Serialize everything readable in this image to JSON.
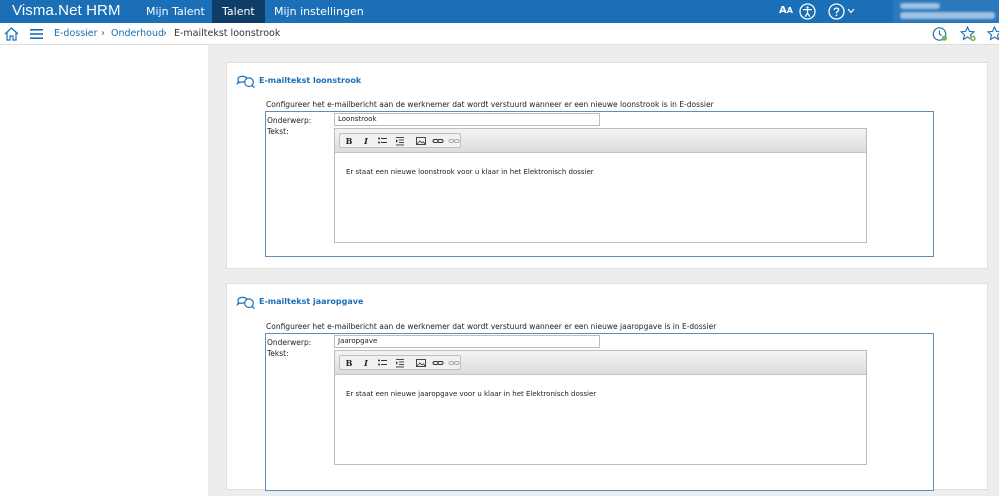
{
  "app": {
    "title": "Visma.Net HRM",
    "nav": [
      {
        "label": "Mijn Talent"
      },
      {
        "label": "Talent"
      },
      {
        "label": "Mijn instellingen"
      }
    ],
    "font_size_label": "A",
    "font_size_label_small": "A",
    "icons": [
      "accessibility-icon",
      "help-icon",
      "chevron-down-icon"
    ]
  },
  "breadcrumb": {
    "items": [
      "E-dossier",
      "Onderhoud"
    ],
    "current": "E-mailtekst loonstrook",
    "separator": "›"
  },
  "panels": [
    {
      "title": "E-mailtekst loonstrook",
      "description": "Configureer het e-mailbericht aan de werknemer dat wordt verstuurd wanneer er een nieuwe loonstrook is in E-dossier",
      "subject_label": "Onderwerp:",
      "subject_value": "Loonstrook",
      "text_label": "Tekst:",
      "body": "Er staat een nieuwe loonstrook voor u klaar in het Elektronisch dossier"
    },
    {
      "title": "E-mailtekst jaaropgave",
      "description": "Configureer het e-mailbericht aan de werknemer dat wordt verstuurd wanneer er een nieuwe jaaropgave is in E-dossier",
      "subject_label": "Onderwerp:",
      "subject_value": "Jaaropgave",
      "text_label": "Tekst:",
      "body": "Er staat een nieuwe jaaropgave voor u klaar in het Elektronisch dossier"
    }
  ],
  "toolbar": {
    "bold": "B",
    "italic": "I",
    "tools": [
      "bold-icon",
      "italic-icon",
      "bulleted-list-icon",
      "indent-icon",
      "image-icon",
      "link-icon",
      "unlink-icon"
    ]
  },
  "colors": {
    "topbar": "#1b6fb6",
    "active_tab": "#0e3e67",
    "link": "#1b6fb6",
    "frame_border": "#5a8fc3"
  }
}
